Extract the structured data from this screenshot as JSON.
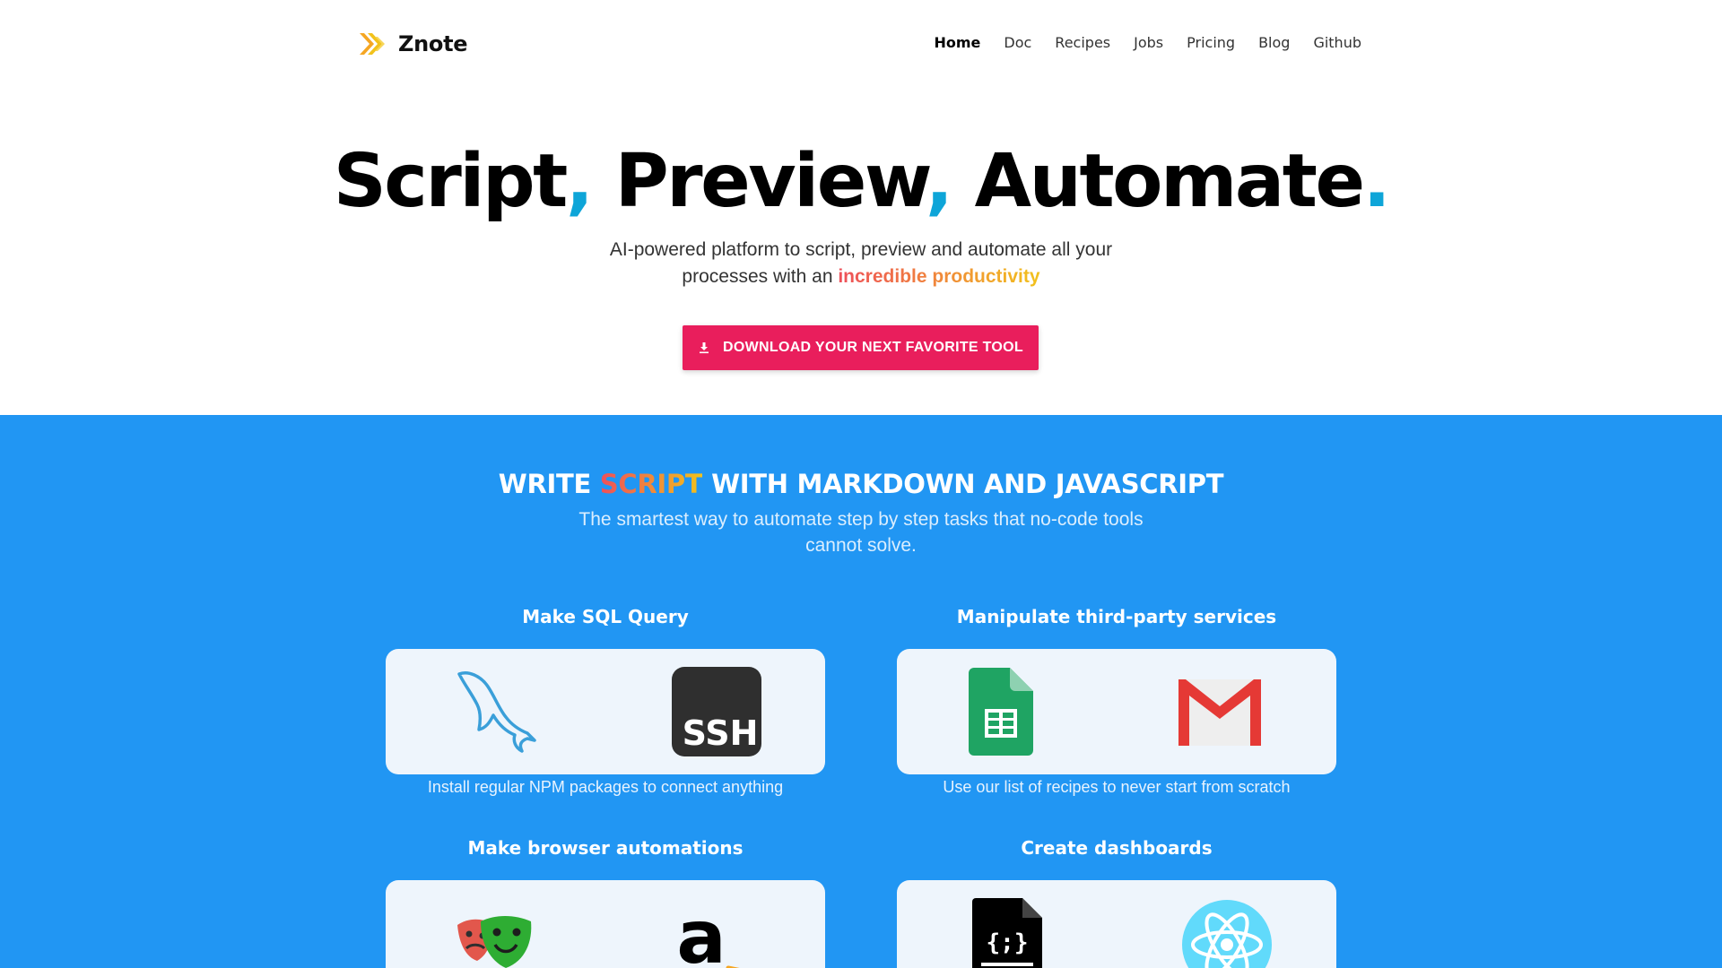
{
  "brand": {
    "name": "Znote"
  },
  "nav": {
    "items": [
      "Home",
      "Doc",
      "Recipes",
      "Jobs",
      "Pricing",
      "Blog",
      "Github"
    ],
    "active": "Home"
  },
  "hero": {
    "title_parts": [
      "Script",
      ",",
      " Preview",
      ",",
      " Automate",
      "."
    ],
    "subtitle_line1": "AI-powered platform to script, preview and automate all your",
    "subtitle_line2_prefix": "processes with an ",
    "subtitle_highlight": "incredible productivity",
    "cta_label": "DOWNLOAD YOUR NEXT FAVORITE TOOL"
  },
  "features": {
    "title_prefix": "WRITE ",
    "title_highlight": "SCRIPT",
    "title_suffix": " WITH MARKDOWN AND JAVASCRIPT",
    "subtitle_line1": "The smartest way to automate step by step tasks that no-code tools",
    "subtitle_line2": "cannot solve.",
    "cards": [
      {
        "heading": "Make SQL Query",
        "caption": "Install regular NPM packages to connect anything",
        "icons": [
          "mysql-dolphin-icon",
          "ssh-icon"
        ]
      },
      {
        "heading": "Manipulate third-party services",
        "caption": "Use our list of recipes to never start from scratch",
        "icons": [
          "google-sheets-icon",
          "gmail-icon"
        ]
      },
      {
        "heading": "Make browser automations",
        "caption": "",
        "icons": [
          "playwright-masks-icon",
          "amazon-icon"
        ]
      },
      {
        "heading": "Create dashboards",
        "caption": "",
        "icons": [
          "json-file-icon",
          "react-icon"
        ]
      }
    ],
    "ssh_label": "SSH",
    "amazon_letter": "a",
    "json_label": "{;}"
  },
  "colors": {
    "accent_blue": "#2196f3",
    "cta": "#e91e5c",
    "title_dot": "#0ea5d8",
    "gradient": [
      "#ee4f5a",
      "#f2c21b"
    ]
  }
}
